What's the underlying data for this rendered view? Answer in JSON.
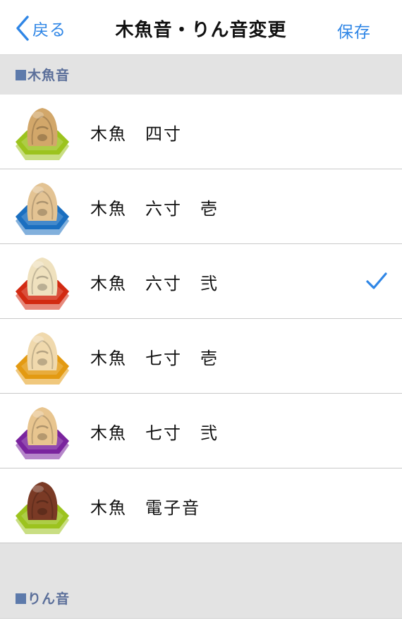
{
  "nav": {
    "back_label": "戻る",
    "title": "木魚音・りん音変更",
    "save_label": "保存"
  },
  "sections": {
    "mokugyo_header": "木魚音",
    "rin_header": "りん音"
  },
  "items": [
    {
      "label": "木魚　四寸",
      "base_color": "#9cc31e",
      "wood_color": "#d2a76a",
      "selected": false
    },
    {
      "label": "木魚　六寸　壱",
      "base_color": "#1b6fc0",
      "wood_color": "#e3c393",
      "selected": false
    },
    {
      "label": "木魚　六寸　弐",
      "base_color": "#d22a12",
      "wood_color": "#efe1be",
      "selected": true
    },
    {
      "label": "木魚　七寸　壱",
      "base_color": "#e39a12",
      "wood_color": "#f0d9ad",
      "selected": false
    },
    {
      "label": "木魚　七寸　弐",
      "base_color": "#7a239e",
      "wood_color": "#e8c58f",
      "selected": false
    },
    {
      "label": "木魚　電子音",
      "base_color": "#9cc31e",
      "wood_color": "#7a3a25",
      "selected": false
    }
  ],
  "colors": {
    "accent": "#2f86e6",
    "section_bg": "#e3e3e3",
    "section_text": "#5b6f9a"
  },
  "icons": [
    "chevron-left-icon",
    "checkmark-icon",
    "mokugyo-thumbnail"
  ]
}
